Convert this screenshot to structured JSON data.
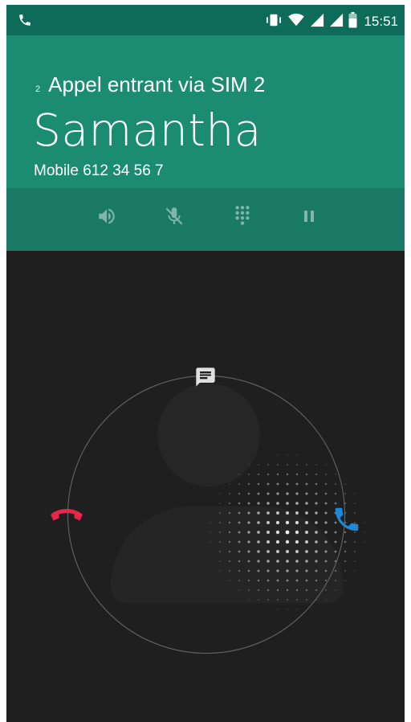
{
  "status_bar": {
    "time": "15:51",
    "left_icon": "phone-icon",
    "icons": [
      "vibrate-icon",
      "wifi-icon",
      "signal-sim1-icon",
      "signal-sim2-icon",
      "battery-icon"
    ]
  },
  "call": {
    "sim_badge": "2",
    "incoming_label": "Appel entrant via SIM 2",
    "caller_name": "Samantha",
    "caller_number": "Mobile 612 34 56 7"
  },
  "actions": [
    {
      "name": "speaker-icon"
    },
    {
      "name": "mute-icon"
    },
    {
      "name": "dialpad-icon"
    },
    {
      "name": "hold-icon"
    }
  ],
  "glowpad": {
    "message_icon": "message-icon",
    "decline_icon": "decline-call-icon",
    "answer_icon": "answer-call-icon"
  },
  "colors": {
    "status_bar": "#0e6b59",
    "header": "#1b8c72",
    "actions_bar": "#1a7a65",
    "background": "#1f1f1f",
    "decline": "#e8264a",
    "answer": "#1e88d8"
  }
}
